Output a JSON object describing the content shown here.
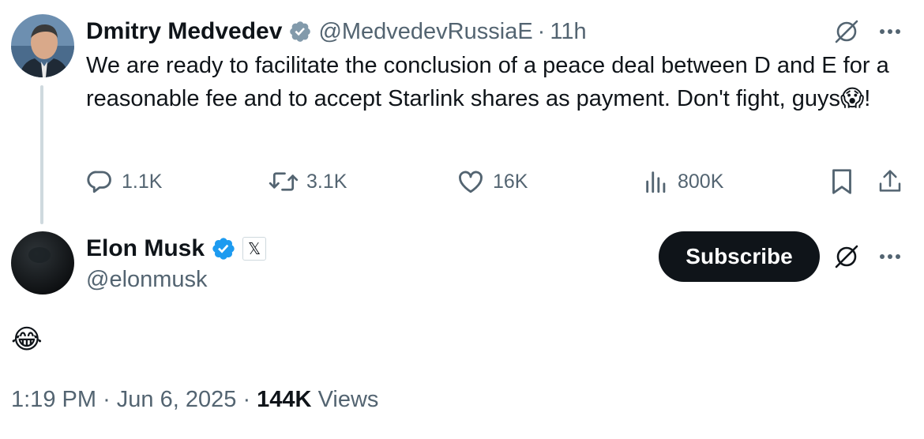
{
  "quoted_tweet": {
    "author_name": "Dmitry Medvedev",
    "handle": "@MedvedevRussiaE",
    "separator": "·",
    "time": "11h",
    "text_main": "We are ready to facilitate the conclusion of a peace deal between D and E for a reasonable fee and to accept Starlink shares as payment. Don't fight, guys",
    "text_emoji": "😱",
    "text_end": "!",
    "verified_badge_color": "#829aab",
    "actions": {
      "replies": "1.1K",
      "reposts": "3.1K",
      "likes": "16K",
      "views": "800K"
    }
  },
  "main_tweet": {
    "author_name": "Elon Musk",
    "handle": "@elonmusk",
    "verified_badge_color": "#1d9bf0",
    "affiliate_badge": "𝕏",
    "subscribe_label": "Subscribe",
    "text": "😂",
    "time": "1:19 PM",
    "date": "Jun 6, 2025",
    "separator": "·",
    "views_count": "144K",
    "views_label": "Views"
  },
  "colors": {
    "text_primary": "#0f1419",
    "text_secondary": "#536471",
    "thread_line": "#cfd9de"
  },
  "icons": [
    "grok-icon",
    "more-icon",
    "reply-icon",
    "repost-icon",
    "like-icon",
    "views-icon",
    "bookmark-icon",
    "share-icon",
    "verified-badge-icon"
  ]
}
